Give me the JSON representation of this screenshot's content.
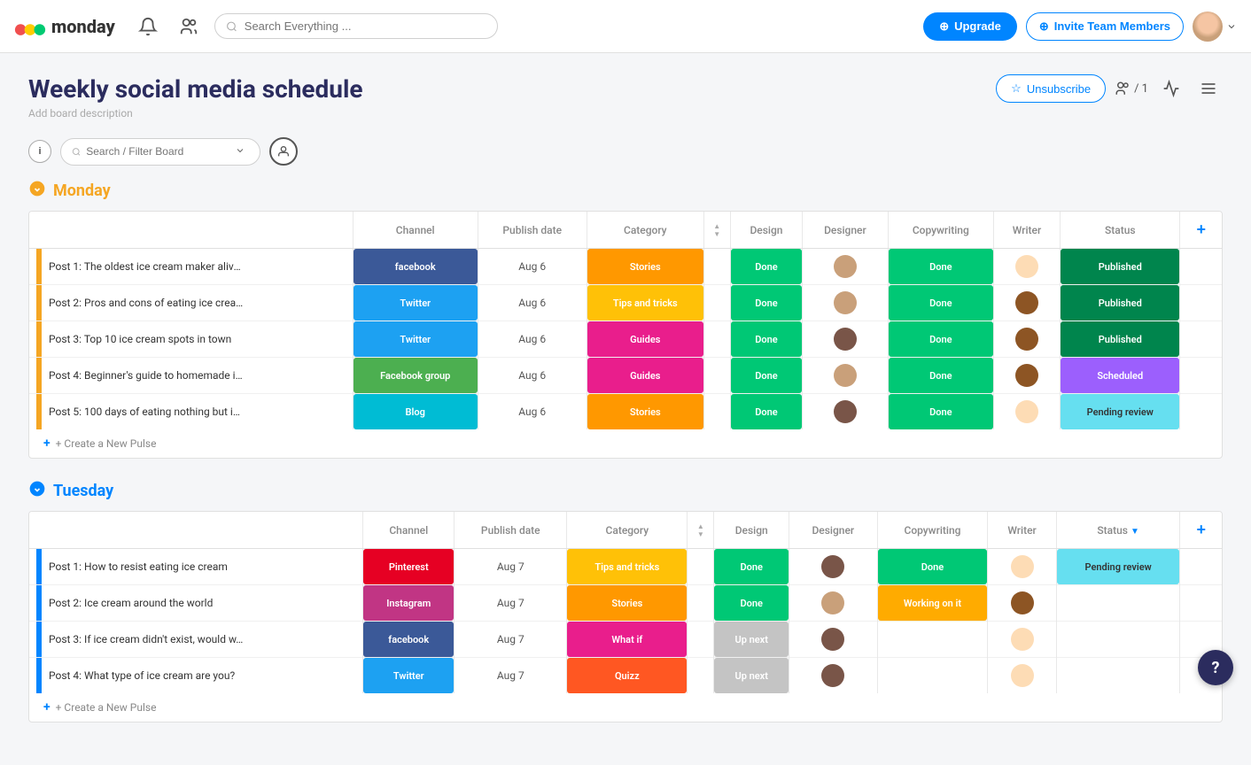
{
  "header": {
    "logo_text": "monday",
    "search_placeholder": "Search Everything ...",
    "upgrade_label": "Upgrade",
    "invite_label": "Invite Team Members"
  },
  "board": {
    "title": "Weekly social media schedule",
    "description": "Add board description",
    "unsubscribe_label": "Unsubscribe",
    "members_count": "/ 1"
  },
  "toolbar": {
    "filter_placeholder": "Search / Filter Board",
    "info_label": "i"
  },
  "groups": [
    {
      "id": "monday",
      "title": "Monday",
      "color": "yellow",
      "columns": [
        "Channel",
        "Publish date",
        "Category",
        ".",
        "Design",
        "Designer",
        "Copywriting",
        "Writer",
        "Status"
      ],
      "rows": [
        {
          "name": "Post 1: The oldest ice cream maker alive...",
          "channel": "facebook",
          "channel_class": "c-facebook",
          "date": "Aug 6",
          "category": "Stories",
          "category_class": "c-stories",
          "design": "Done",
          "design_class": "c-done",
          "designer_av": "av1",
          "copy": "Done",
          "copy_class": "c-done",
          "writer_av": "av3",
          "status": "Published",
          "status_class": "c-published",
          "bar": "left-bar-yellow"
        },
        {
          "name": "Post 2: Pros and cons of eating ice crea...",
          "channel": "Twitter",
          "channel_class": "c-twitter",
          "date": "Aug 6",
          "category": "Tips and tricks",
          "category_class": "c-tips",
          "design": "Done",
          "design_class": "c-done",
          "designer_av": "av1",
          "copy": "Done",
          "copy_class": "c-done",
          "writer_av": "av2",
          "status": "Published",
          "status_class": "c-published",
          "bar": "left-bar-yellow"
        },
        {
          "name": "Post 3: Top 10 ice cream spots in town",
          "channel": "Twitter",
          "channel_class": "c-twitter",
          "date": "Aug 6",
          "category": "Guides",
          "category_class": "c-guides",
          "design": "Done",
          "design_class": "c-done",
          "designer_av": "av4",
          "copy": "Done",
          "copy_class": "c-done",
          "writer_av": "av2",
          "status": "Published",
          "status_class": "c-published",
          "bar": "left-bar-yellow"
        },
        {
          "name": "Post 4: Beginner's guide to homemade ic...",
          "channel": "Facebook group",
          "channel_class": "c-facebook-group",
          "date": "Aug 6",
          "category": "Guides",
          "category_class": "c-guides",
          "design": "Done",
          "design_class": "c-done",
          "designer_av": "av1",
          "copy": "Done",
          "copy_class": "c-done",
          "writer_av": "av2",
          "status": "Scheduled",
          "status_class": "c-scheduled",
          "bar": "left-bar-yellow"
        },
        {
          "name": "Post 5: 100 days of eating nothing but ic...",
          "channel": "Blog",
          "channel_class": "c-blog",
          "date": "Aug 6",
          "category": "Stories",
          "category_class": "c-stories",
          "design": "Done",
          "design_class": "c-done",
          "designer_av": "av4",
          "copy": "Done",
          "copy_class": "c-done",
          "writer_av": "av3",
          "status": "Pending review",
          "status_class": "c-pending",
          "bar": "left-bar-yellow"
        }
      ],
      "add_row_label": "+ Create a New Pulse"
    },
    {
      "id": "tuesday",
      "title": "Tuesday",
      "color": "blue",
      "columns": [
        "Channel",
        "Publish date",
        "Category",
        ".",
        "Design",
        "Designer",
        "Copywriting",
        "Writer",
        "Status"
      ],
      "rows": [
        {
          "name": "Post 1: How to resist eating ice cream",
          "channel": "Pinterest",
          "channel_class": "c-pinterest",
          "date": "Aug 7",
          "category": "Tips and tricks",
          "category_class": "c-tips",
          "design": "Done",
          "design_class": "c-done",
          "designer_av": "av4",
          "copy": "Done",
          "copy_class": "c-done",
          "writer_av": "av3",
          "status": "Pending review",
          "status_class": "c-pending",
          "bar": "left-bar-blue"
        },
        {
          "name": "Post 2: Ice cream around the world",
          "channel": "Instagram",
          "channel_class": "c-instagram",
          "date": "Aug 7",
          "category": "Stories",
          "category_class": "c-stories",
          "design": "Done",
          "design_class": "c-done",
          "designer_av": "av1",
          "copy": "Working on it",
          "copy_class": "c-workon",
          "writer_av": "av2",
          "status": "",
          "status_class": "",
          "bar": "left-bar-blue"
        },
        {
          "name": "Post 3: If ice cream didn't exist, would w...",
          "channel": "facebook",
          "channel_class": "c-facebook",
          "date": "Aug 7",
          "category": "What if",
          "category_class": "c-whatif",
          "design": "Up next",
          "design_class": "c-upnext",
          "designer_av": "av4",
          "copy": "",
          "copy_class": "",
          "writer_av": "av3",
          "status": "",
          "status_class": "",
          "bar": "left-bar-blue"
        },
        {
          "name": "Post 4: What type of ice cream are you?",
          "channel": "Twitter",
          "channel_class": "c-twitter",
          "date": "Aug 7",
          "category": "Quizz",
          "category_class": "c-quizz",
          "design": "Up next",
          "design_class": "c-upnext",
          "designer_av": "av4",
          "copy": "",
          "copy_class": "",
          "writer_av": "av3",
          "status": "",
          "status_class": "",
          "bar": "left-bar-blue"
        }
      ],
      "add_row_label": "+ Create a New Pulse"
    }
  ]
}
